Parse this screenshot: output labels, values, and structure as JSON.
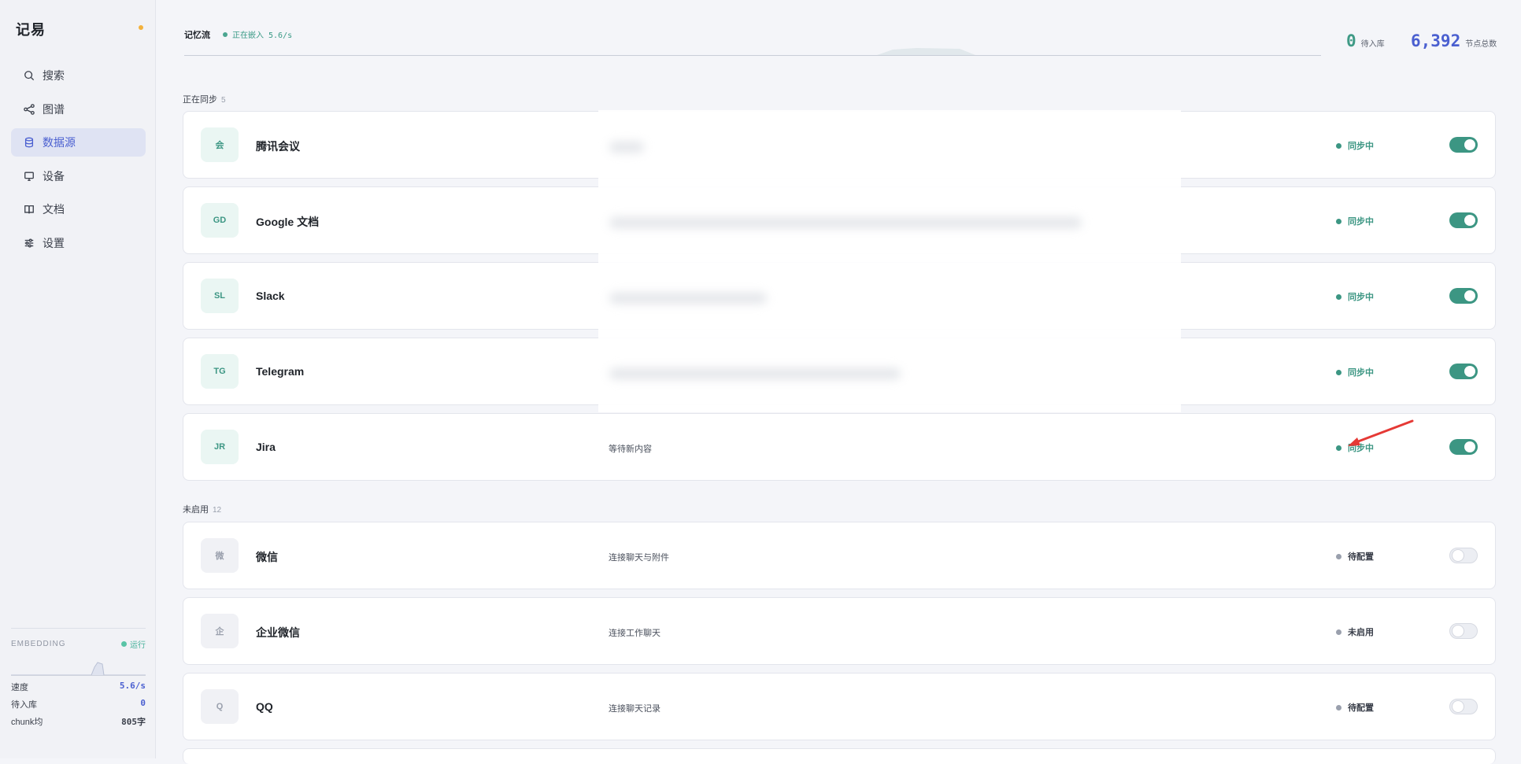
{
  "app": {
    "brand": "记易"
  },
  "nav": {
    "items": [
      {
        "label": "搜索",
        "icon": "search-icon"
      },
      {
        "label": "图谱",
        "icon": "graph-icon"
      },
      {
        "label": "数据源",
        "icon": "database-icon",
        "active": true
      },
      {
        "label": "设备",
        "icon": "monitor-icon"
      },
      {
        "label": "文档",
        "icon": "book-icon"
      },
      {
        "label": "设置",
        "icon": "sliders-icon"
      }
    ]
  },
  "embedding": {
    "title": "EMBEDDING",
    "status": "运行",
    "speed_label": "速度",
    "speed_value": "5.6/s",
    "pending_label": "待入库",
    "pending_value": "0",
    "chunk_label": "chunk均",
    "chunk_value": "805字"
  },
  "header": {
    "title": "记忆流",
    "live": "正在嵌入 5.6/s",
    "pending_num": "0",
    "pending_label": "待入库",
    "total_num": "6,392",
    "total_label": "节点总数"
  },
  "sections": {
    "syncing": {
      "label": "正在同步",
      "count": "5"
    },
    "disabled": {
      "label": "未启用",
      "count": "12"
    }
  },
  "sources_active": [
    {
      "abbr": "会",
      "name": "腾讯会议",
      "desc": "",
      "status": "同步中"
    },
    {
      "abbr": "GD",
      "name": "Google 文档",
      "desc": "",
      "status": "同步中"
    },
    {
      "abbr": "SL",
      "name": "Slack",
      "desc": "",
      "status": "同步中"
    },
    {
      "abbr": "TG",
      "name": "Telegram",
      "desc": "",
      "status": "同步中"
    },
    {
      "abbr": "JR",
      "name": "Jira",
      "desc": "等待新内容",
      "status": "同步中"
    }
  ],
  "sources_disabled": [
    {
      "abbr": "微",
      "name": "微信",
      "desc": "连接聊天与附件",
      "status": "待配置"
    },
    {
      "abbr": "企",
      "name": "企业微信",
      "desc": "连接工作聊天",
      "status": "未启用"
    },
    {
      "abbr": "Q",
      "name": "QQ",
      "desc": "连接聊天记录",
      "status": "待配置"
    }
  ],
  "colors": {
    "accent": "#4a5fd0",
    "green": "#3c9683",
    "annotation_arrow": "#e53935"
  }
}
